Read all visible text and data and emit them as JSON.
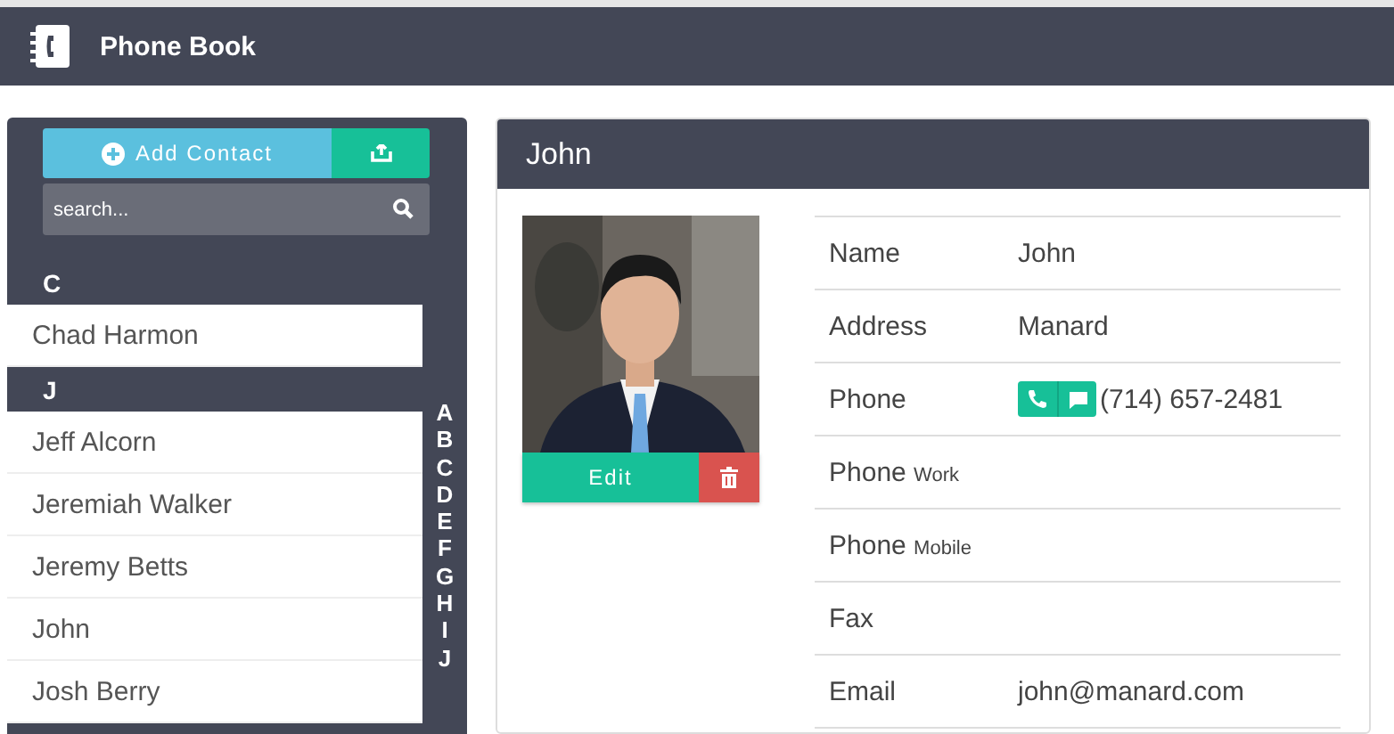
{
  "app": {
    "title": "Phone Book"
  },
  "sidebar": {
    "add_button": "Add Contact",
    "search": {
      "placeholder": "search..."
    },
    "sections": [
      {
        "letter": "C",
        "contacts": [
          "Chad Harmon"
        ]
      },
      {
        "letter": "J",
        "contacts": [
          "Jeff Alcorn",
          "Jeremiah Walker",
          "Jeremy Betts",
          "John",
          "Josh Berry"
        ]
      }
    ],
    "index": [
      "A",
      "B",
      "C",
      "D",
      "E",
      "F",
      "G",
      "H",
      "I",
      "J"
    ]
  },
  "contact": {
    "title": "John",
    "edit_button": "Edit",
    "fields": [
      {
        "kind": "text",
        "label": "Name",
        "value": "John"
      },
      {
        "kind": "text",
        "label": "Address",
        "value": "Manard"
      },
      {
        "kind": "phone",
        "label": "Phone",
        "value": "(714) 657-2481"
      },
      {
        "kind": "text",
        "label": "Phone",
        "sublabel": "Work"
      },
      {
        "kind": "text",
        "label": "Phone",
        "sublabel": "Mobile"
      },
      {
        "kind": "text",
        "label": "Fax"
      },
      {
        "kind": "text",
        "label": "Email",
        "value": "john@manard.com"
      }
    ]
  }
}
